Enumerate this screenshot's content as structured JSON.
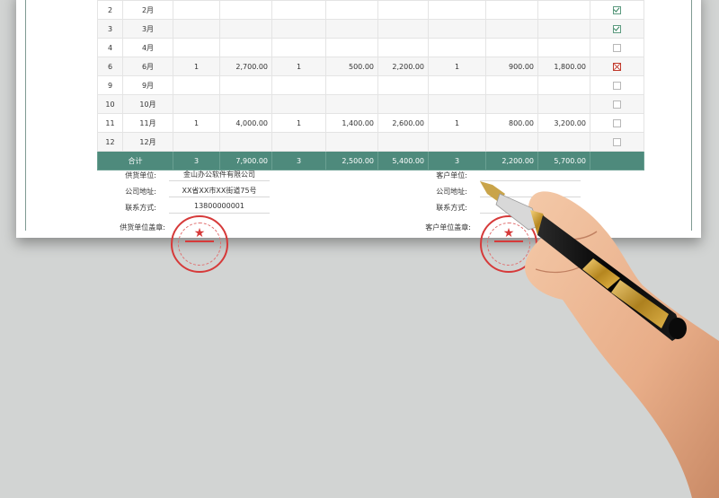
{
  "table": {
    "rows": [
      {
        "no": "2",
        "month": "2月",
        "c1": "",
        "c2": "",
        "c3": "",
        "c4": "",
        "c5": "",
        "c6": "",
        "c7": "",
        "c8": "",
        "status": "checked"
      },
      {
        "no": "3",
        "month": "3月",
        "c1": "",
        "c2": "",
        "c3": "",
        "c4": "",
        "c5": "",
        "c6": "",
        "c7": "",
        "c8": "",
        "status": "checked"
      },
      {
        "no": "4",
        "month": "4月",
        "c1": "",
        "c2": "",
        "c3": "",
        "c4": "",
        "c5": "",
        "c6": "",
        "c7": "",
        "c8": "",
        "status": "empty"
      },
      {
        "no": "6",
        "month": "6月",
        "c1": "1",
        "c2": "2,700.00",
        "c3": "1",
        "c4": "500.00",
        "c5": "2,200.00",
        "c6": "1",
        "c7": "900.00",
        "c8": "1,800.00",
        "status": "crossed"
      },
      {
        "no": "9",
        "month": "9月",
        "c1": "",
        "c2": "",
        "c3": "",
        "c4": "",
        "c5": "",
        "c6": "",
        "c7": "",
        "c8": "",
        "status": "empty"
      },
      {
        "no": "10",
        "month": "10月",
        "c1": "",
        "c2": "",
        "c3": "",
        "c4": "",
        "c5": "",
        "c6": "",
        "c7": "",
        "c8": "",
        "status": "empty"
      },
      {
        "no": "11",
        "month": "11月",
        "c1": "1",
        "c2": "4,000.00",
        "c3": "1",
        "c4": "1,400.00",
        "c5": "2,600.00",
        "c6": "1",
        "c7": "800.00",
        "c8": "3,200.00",
        "status": "empty"
      },
      {
        "no": "12",
        "month": "12月",
        "c1": "",
        "c2": "",
        "c3": "",
        "c4": "",
        "c5": "",
        "c6": "",
        "c7": "",
        "c8": "",
        "status": "empty"
      }
    ],
    "total": {
      "label": "合计",
      "c1": "3",
      "c2": "7,900.00",
      "c3": "3",
      "c4": "2,500.00",
      "c5": "5,400.00",
      "c6": "3",
      "c7": "2,200.00",
      "c8": "5,700.00"
    }
  },
  "supplier": {
    "unit_label": "供货单位:",
    "unit_value": "金山办公软件有限公司",
    "address_label": "公司地址:",
    "address_value": "XX省XX市XX街道75号",
    "contact_label": "联系方式:",
    "contact_value": "13800000001",
    "seal_label": "供货单位盖章:"
  },
  "customer": {
    "unit_label": "客户单位:",
    "address_label": "公司地址:",
    "contact_label": "联系方式:",
    "seal_label": "客户单位盖章:"
  },
  "colors": {
    "total_row": "#4e8a7c",
    "seal": "#d63a3a",
    "background": "#d2d4d3"
  },
  "icons": {
    "checked": "checkbox-checked-icon",
    "crossed": "checkbox-crossed-icon",
    "empty": "checkbox-empty-icon"
  }
}
